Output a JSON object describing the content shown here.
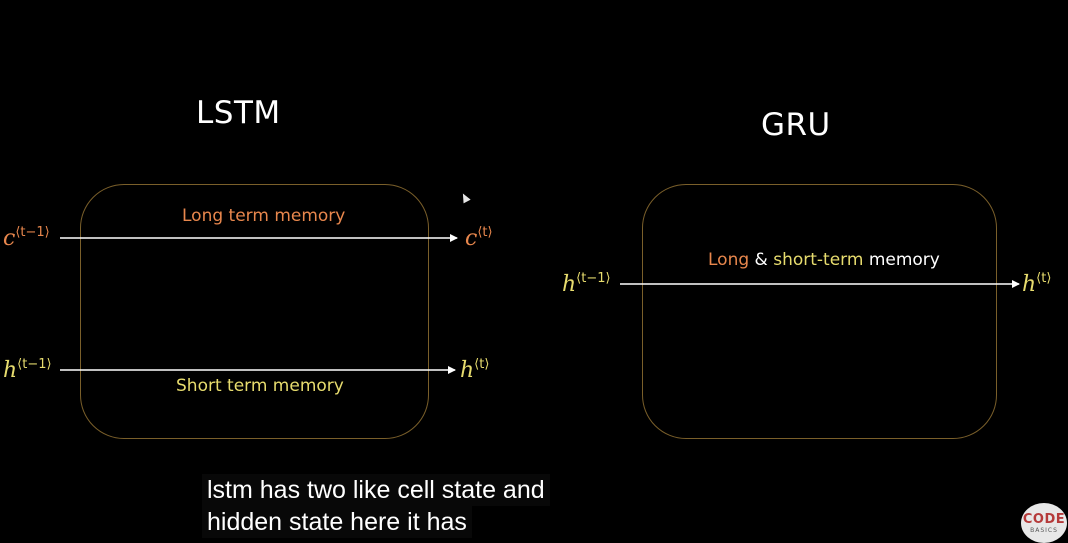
{
  "lstm": {
    "title": "LSTM",
    "long_term_label": "Long term memory",
    "short_term_label": "Short term memory",
    "c_in": {
      "symbol": "c",
      "sup": "⟨t−1⟩"
    },
    "c_out": {
      "symbol": "c",
      "sup": "⟨t⟩"
    },
    "h_in": {
      "symbol": "h",
      "sup": "⟨t−1⟩"
    },
    "h_out": {
      "symbol": "h",
      "sup": "⟨t⟩"
    }
  },
  "gru": {
    "title": "GRU",
    "label_long": "Long",
    "label_amp": "&",
    "label_short": "short-term",
    "label_memory": "memory",
    "h_in": {
      "symbol": "h",
      "sup": "⟨t−1⟩"
    },
    "h_out": {
      "symbol": "h",
      "sup": "⟨t⟩"
    }
  },
  "caption": {
    "line1": "lstm has two like cell state and",
    "line2": "hidden state here it has"
  },
  "logo": {
    "top": "CODE",
    "bottom": "BASICS"
  },
  "colors": {
    "background": "#000000",
    "cell_state": "#e8874d",
    "hidden_state": "#e7dc6e",
    "box_border": "#7a5f2a"
  }
}
